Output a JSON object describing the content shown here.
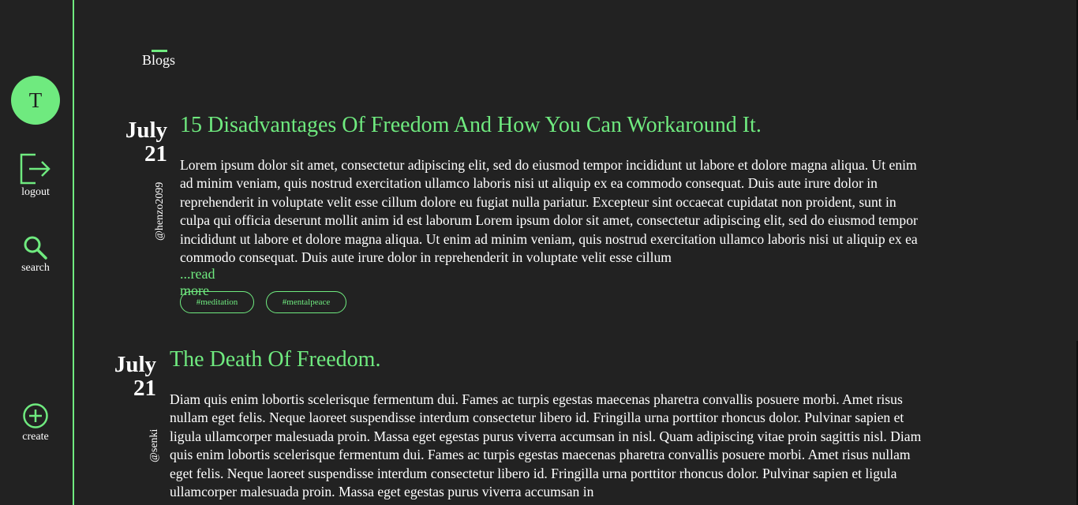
{
  "sidebar": {
    "avatar_initial": "T",
    "logout_label": "logout",
    "search_label": "search",
    "create_label": "create"
  },
  "header": {
    "section_tab": "Blogs"
  },
  "posts": [
    {
      "month": "July",
      "day": "21",
      "author": "@henzo2099",
      "title": "15 Disadvantages Of Freedom And How You Can Workaround It.",
      "body": "Lorem ipsum dolor sit amet, consectetur adipiscing elit, sed do eiusmod tempor incididunt ut labore et dolore magna aliqua. Ut enim ad minim veniam, quis nostrud exercitation ullamco laboris nisi ut aliquip ex ea commodo consequat. Duis aute irure dolor in reprehenderit in voluptate velit esse cillum dolore eu fugiat nulla pariatur. Excepteur sint occaecat cupidatat non proident, sunt in culpa qui officia deserunt mollit anim id est laborum Lorem ipsum dolor sit amet, consectetur adipiscing elit, sed do eiusmod tempor incididunt ut labore et dolore magna aliqua. Ut enim ad minim veniam, quis nostrud exercitation ullamco laboris nisi ut aliquip ex ea commodo consequat. Duis aute irure dolor in reprehenderit in voluptate velit esse cillum",
      "read_more": "...read more",
      "tags": [
        "#meditation",
        "#mentalpeace"
      ]
    },
    {
      "month": "July",
      "day": "21",
      "author": "@senki",
      "title": "The Death Of Freedom.",
      "body": "Diam quis enim lobortis scelerisque fermentum dui. Fames ac turpis egestas maecenas pharetra convallis posuere morbi. Amet risus nullam eget felis. Neque laoreet suspendisse interdum consectetur libero id. Fringilla urna porttitor rhoncus dolor. Pulvinar sapien et ligula ullamcorper malesuada proin. Massa eget egestas purus viverra accumsan in nisl. Quam adipiscing vitae proin sagittis nisl. Diam quis enim lobortis scelerisque fermentum dui. Fames ac turpis egestas maecenas pharetra convallis posuere morbi. Amet risus nullam eget felis. Neque laoreet suspendisse interdum consectetur libero id. Fringilla urna porttitor rhoncus dolor. Pulvinar sapien et ligula ullamcorper malesuada proin. Massa eget egestas purus viverra accumsan in"
    }
  ],
  "colors": {
    "accent": "#6fea7f",
    "background": "#222222",
    "text": "#ffffff"
  }
}
